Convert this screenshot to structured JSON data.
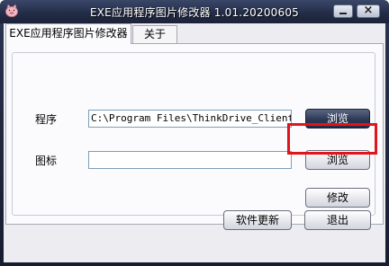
{
  "window": {
    "title": "EXE应用程序图片修改器 1.01.20200605",
    "minimize_symbol": "_",
    "close_symbol": "×"
  },
  "tabs": [
    {
      "label": "EXE应用程序图片修改器",
      "active": true
    },
    {
      "label": "关于",
      "active": false
    }
  ],
  "form": {
    "program_label": "程序",
    "program_value": "C:\\Program Files\\ThinkDrive_Client\\ThinkDrive.exe",
    "browse_program_label": "浏览",
    "icon_label": "图标",
    "icon_value": "",
    "browse_icon_label": "浏览",
    "modify_label": "修改"
  },
  "footer": {
    "update_label": "软件更新",
    "exit_label": "退出"
  },
  "colors": {
    "title_bar": "#242d48",
    "highlight": "#e0141b",
    "dark_button": "#2d3854"
  },
  "icons": {
    "app": "pig-icon",
    "minimize": "minimize-icon",
    "close": "close-icon"
  }
}
